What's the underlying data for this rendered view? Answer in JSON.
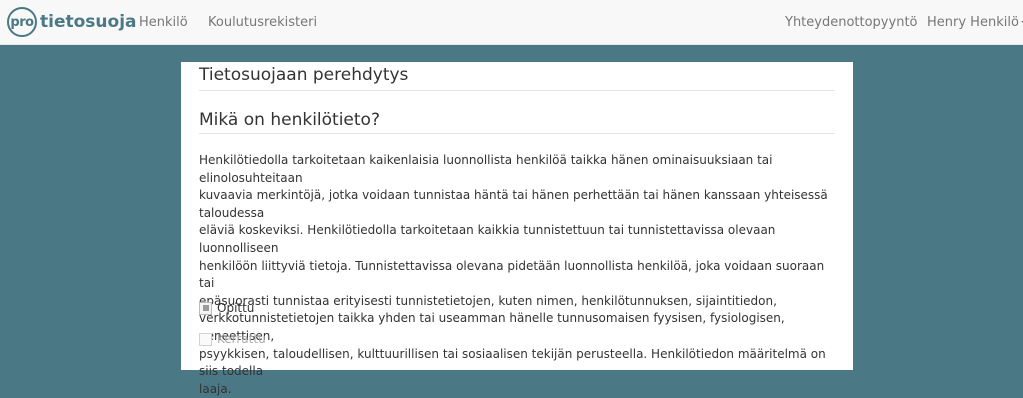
{
  "brand": {
    "mark": "pro",
    "name": "tietosuoja"
  },
  "nav": {
    "left": [
      "Henkilö",
      "Koulutusrekisteri"
    ],
    "contact": "Yhteydenottopyyntö",
    "user": "Henry Henkilö"
  },
  "page": {
    "title": "Tietosuojaan perehdytys",
    "section_title": "Mikä on henkilötieto?",
    "paragraph_lines": [
      "Henkilötiedolla tarkoitetaan kaikenlaisia luonnollista henkilöä taikka hänen ominaisuuksiaan tai elinolosuhteitaan",
      "kuvaavia merkintöjä, jotka voidaan tunnistaa häntä tai hänen perhettään tai hänen kanssaan yhteisessä taloudessa",
      "eläviä koskeviksi. Henkilötiedolla tarkoitetaan kaikkia tunnistettuun tai tunnistettavissa olevaan luonnolliseen",
      "henkilöön liittyviä tietoja. Tunnistettavissa olevana pidetään luonnollista henkilöä, joka voidaan suoraan tai",
      "epäsuorasti tunnistaa erityisesti tunnistetietojen, kuten nimen, henkilötunnuksen, sijaintitiedon,",
      "verkkotunnistetietojen taikka yhden tai useamman hänelle tunnusomaisen fyysisen, fysiologisen, geneettisen,",
      "psyykkisen, taloudellisen, kulttuurillisen tai sosiaalisen tekijän perusteella. Henkilötiedon määritelmä on siis todella",
      "laaja."
    ],
    "checks": [
      {
        "label": "Opittu",
        "checked": true,
        "disabled": false
      },
      {
        "label": "Kerrattu",
        "checked": false,
        "disabled": true
      }
    ]
  },
  "colors": {
    "brand": "#4a7985",
    "background": "#4a7985",
    "navbar": "#f8f8f8"
  }
}
